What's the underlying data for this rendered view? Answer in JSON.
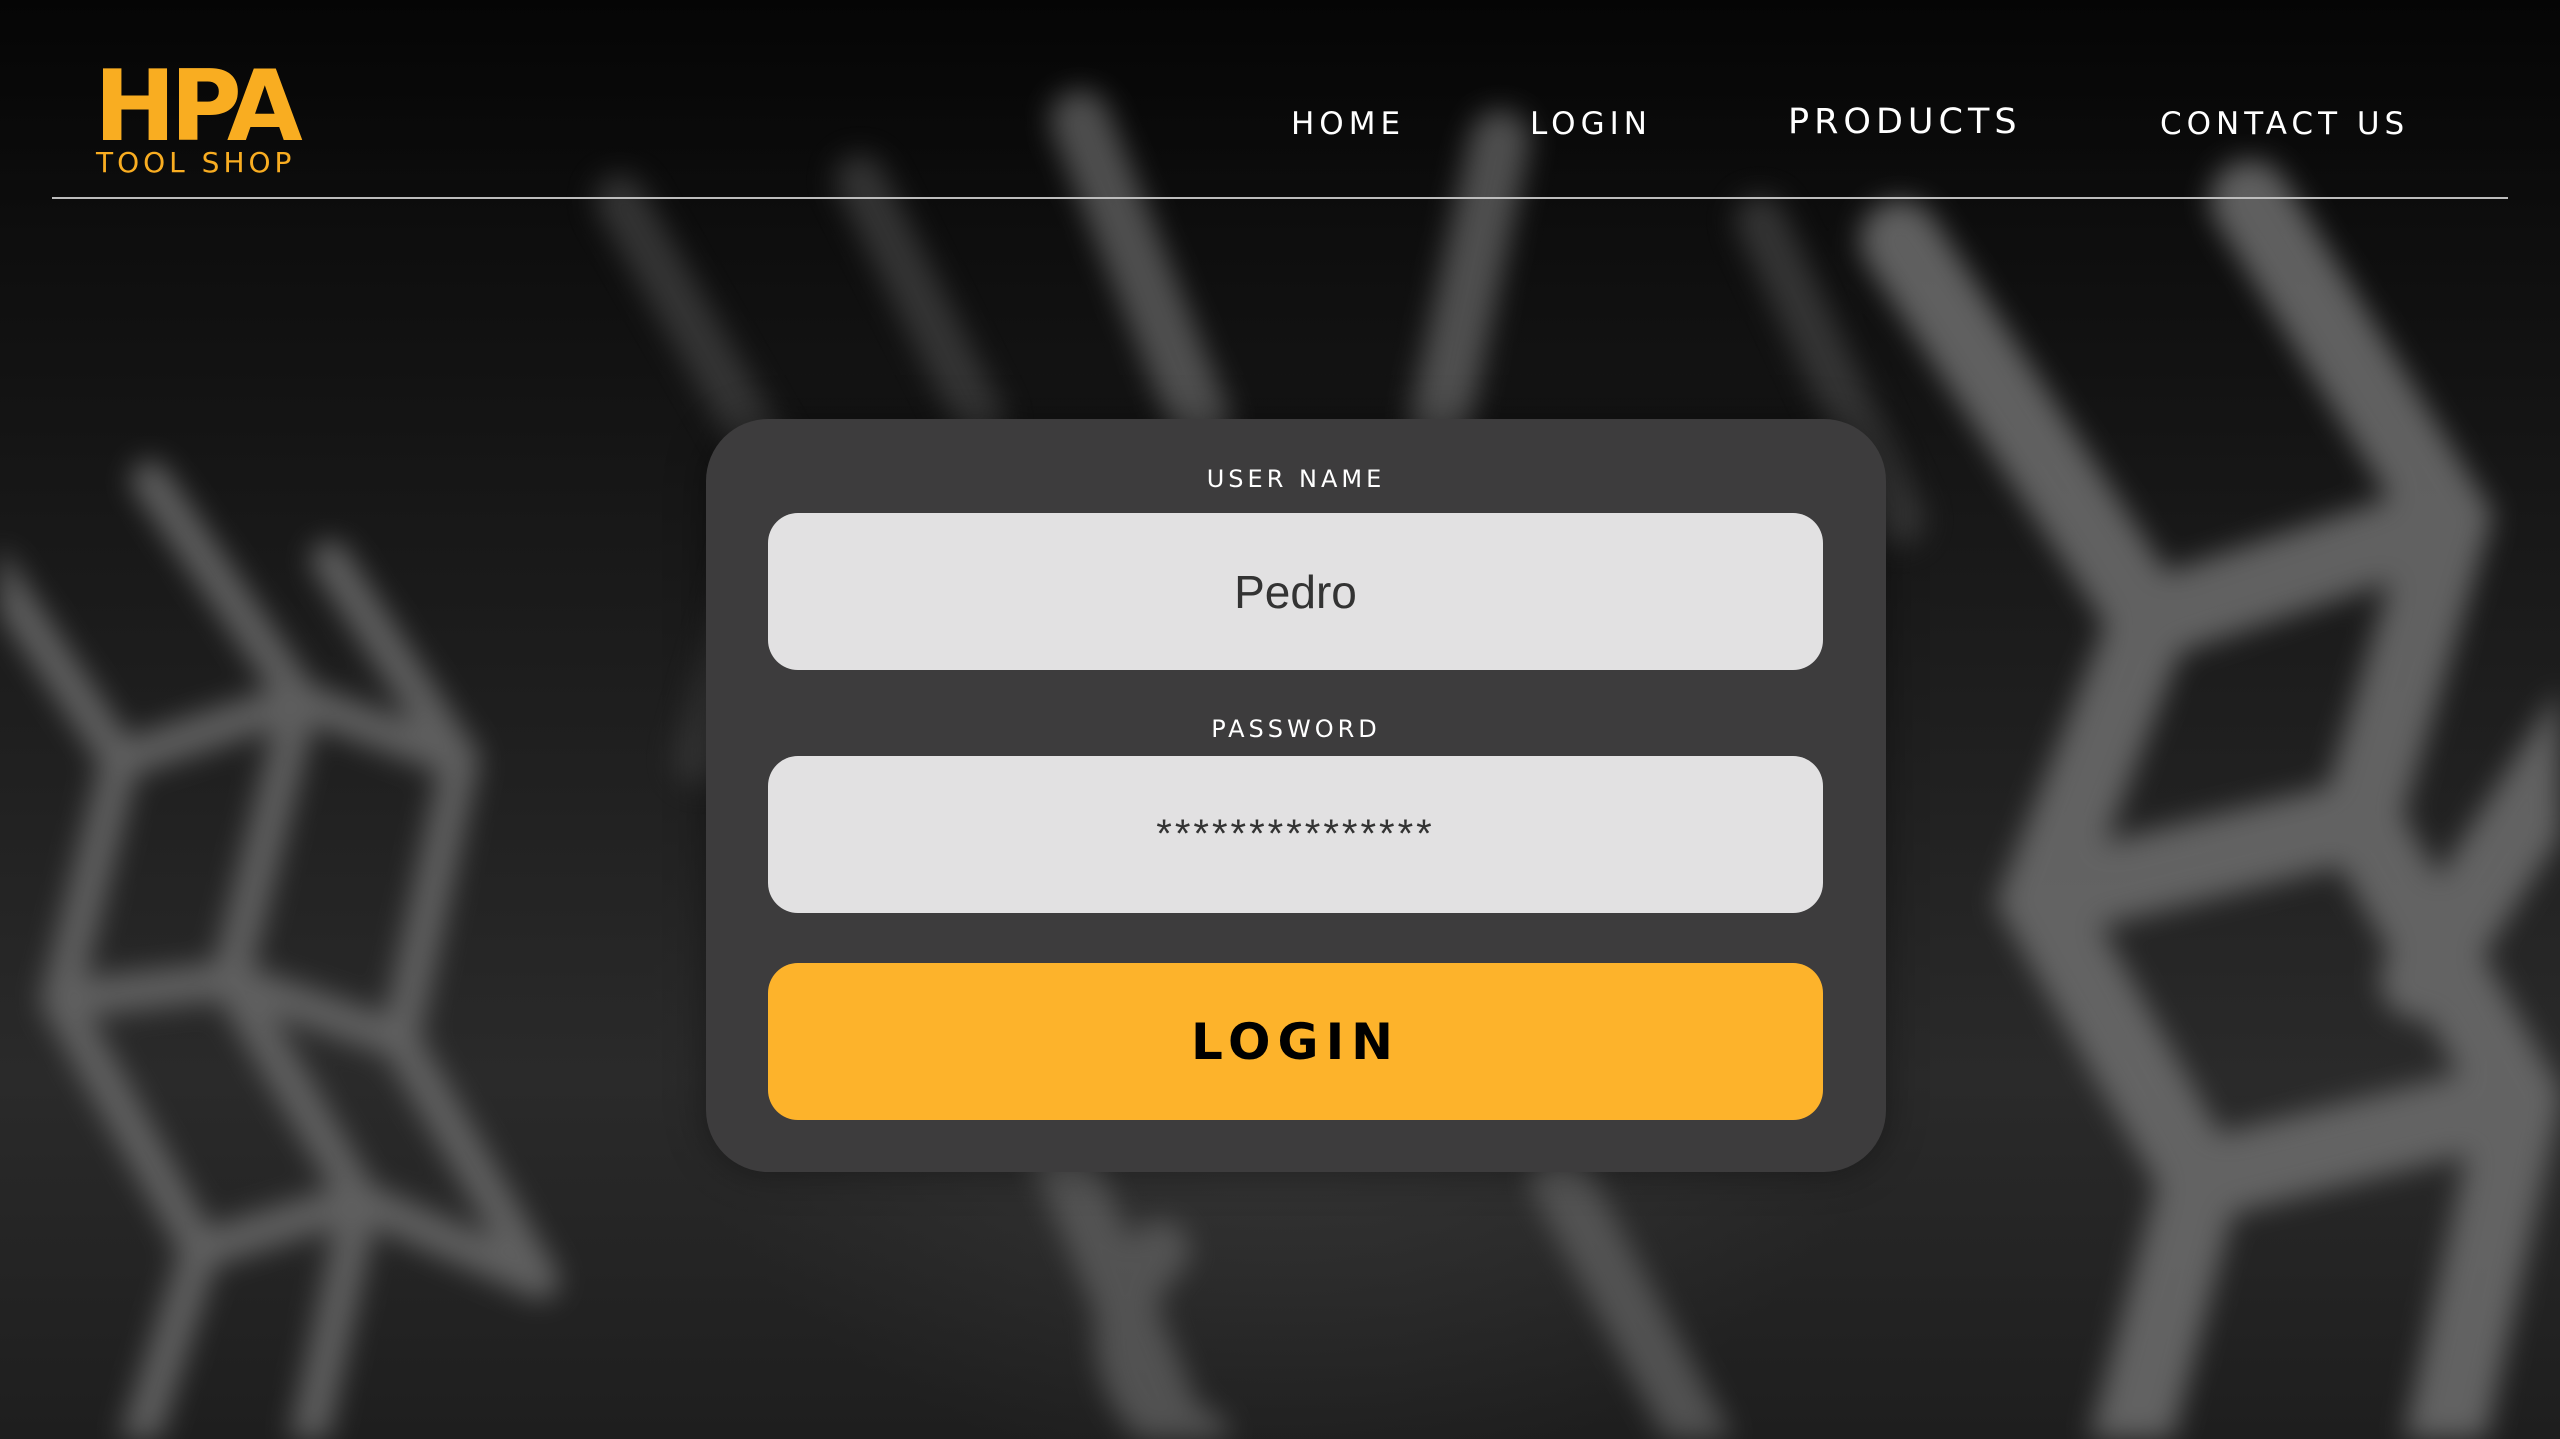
{
  "brand": {
    "logo_mark": "HPA",
    "logo_sub": "TOOL SHOP",
    "accent_color": "#f9ad21"
  },
  "nav": {
    "items": [
      {
        "label": "HOME"
      },
      {
        "label": "LOGIN"
      },
      {
        "label": "PRODUCTS"
      },
      {
        "label": "CONTACT US"
      }
    ]
  },
  "login_form": {
    "username_label": "USER NAME",
    "username_value": "Pedro",
    "password_label": "PASSWORD",
    "password_value": "***************",
    "submit_label": "LOGIN",
    "card_color": "#3d3c3d",
    "field_color": "#e2e1e2",
    "button_color": "#fdb32b"
  }
}
